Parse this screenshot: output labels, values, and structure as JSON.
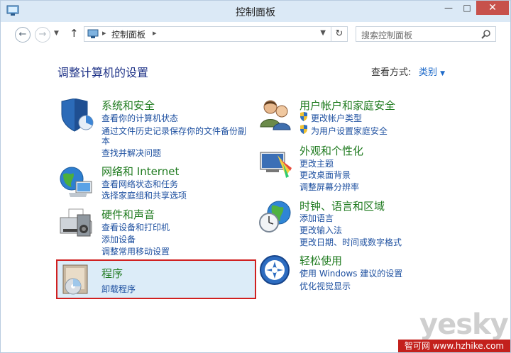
{
  "window": {
    "title": "控制面板"
  },
  "address": {
    "path": "控制面板"
  },
  "search": {
    "placeholder": "搜索控制面板"
  },
  "header": {
    "heading": "调整计算机的设置",
    "view_by_label": "查看方式:",
    "view_by_value": "类别"
  },
  "categories_left": [
    {
      "title": "系统和安全",
      "links": [
        "查看你的计算机状态",
        "通过文件历史记录保存你的文件备份副",
        "本",
        "查找并解决问题"
      ]
    },
    {
      "title": "网络和 Internet",
      "links": [
        "查看网络状态和任务",
        "选择家庭组和共享选项"
      ]
    },
    {
      "title": "硬件和声音",
      "links": [
        "查看设备和打印机",
        "添加设备",
        "调整常用移动设置"
      ]
    },
    {
      "title": "程序",
      "links": [
        "卸载程序"
      ]
    }
  ],
  "categories_right": [
    {
      "title": "用户帐户和家庭安全",
      "links": [
        "更改帐户类型",
        "为用户设置家庭安全"
      ]
    },
    {
      "title": "外观和个性化",
      "links": [
        "更改主题",
        "更改桌面背景",
        "调整屏幕分辨率"
      ]
    },
    {
      "title": "时钟、语言和区域",
      "links": [
        "添加语言",
        "更改输入法",
        "更改日期、时间或数字格式"
      ]
    },
    {
      "title": "轻松使用",
      "links": [
        "使用 Windows 建议的设置",
        "优化视觉显示"
      ]
    }
  ],
  "watermark": {
    "text": "yesky",
    "footer": "智可网 www.hzhike.com"
  }
}
